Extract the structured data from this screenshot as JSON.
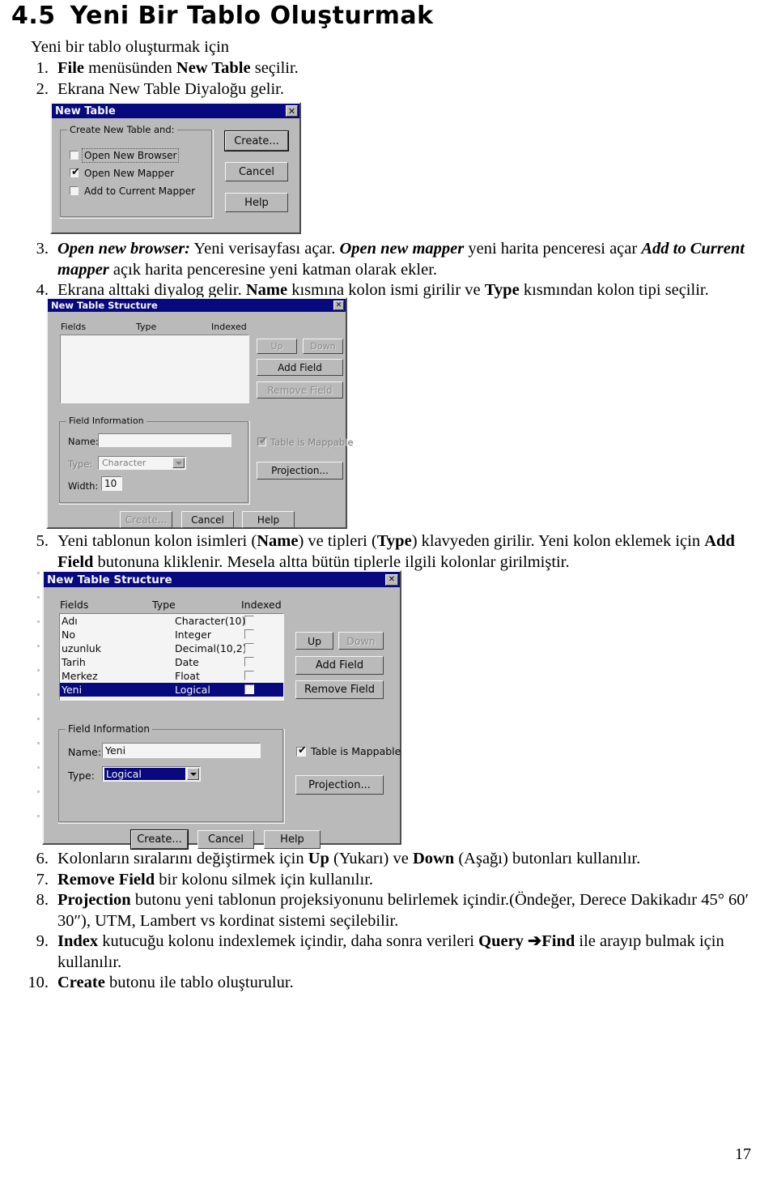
{
  "document": {
    "heading_number": "4.5",
    "heading_title": "Yeni Bir Tablo Oluşturmak",
    "intro": "Yeni bir tablo oluşturmak için",
    "page_number": "17",
    "steps": [
      {
        "marker": "1.",
        "parts": [
          {
            "t": "File",
            "s": "b"
          },
          {
            "t": " menüsünden ",
            "s": "n"
          },
          {
            "t": "New Table",
            "s": "b"
          },
          {
            "t": " seçilir.",
            "s": "n"
          }
        ]
      },
      {
        "marker": "2.",
        "parts": [
          {
            "t": "Ekrana New Table Diyaloğu gelir.",
            "s": "n"
          }
        ]
      },
      {
        "marker": "3.",
        "parts": [
          {
            "t": "Open new browser:",
            "s": "bi"
          },
          {
            "t": " Yeni verisayfası açar. ",
            "s": "n"
          },
          {
            "t": "Open new mapper",
            "s": "bi"
          },
          {
            "t": " yeni harita penceresi açar ",
            "s": "n"
          },
          {
            "t": "Add to Current mapper",
            "s": "bi"
          },
          {
            "t": " açık harita penceresine yeni katman olarak ekler.",
            "s": "n"
          }
        ]
      },
      {
        "marker": "4.",
        "parts": [
          {
            "t": "Ekrana alttaki diyalog gelir. ",
            "s": "n"
          },
          {
            "t": "Name",
            "s": "b"
          },
          {
            "t": " kısmına kolon ismi girilir ve ",
            "s": "n"
          },
          {
            "t": "Type",
            "s": "b"
          },
          {
            "t": " kısmından kolon tipi seçilir.",
            "s": "n"
          }
        ]
      },
      {
        "marker": "5.",
        "parts": [
          {
            "t": "Yeni tablonun kolon isimleri (",
            "s": "n"
          },
          {
            "t": "Name",
            "s": "b"
          },
          {
            "t": ") ve tipleri (",
            "s": "n"
          },
          {
            "t": "Type",
            "s": "b"
          },
          {
            "t": ") klavyeden girilir. Yeni kolon eklemek için ",
            "s": "n"
          },
          {
            "t": "Add Field",
            "s": "b"
          },
          {
            "t": " butonuna kliklenir. Mesela altta bütün tiplerle ilgili kolonlar girilmiştir.",
            "s": "n"
          }
        ]
      },
      {
        "marker": "6.",
        "parts": [
          {
            "t": "Kolonların sıralarını değiştirmek için ",
            "s": "n"
          },
          {
            "t": "Up",
            "s": "b"
          },
          {
            "t": " (Yukarı) ve ",
            "s": "n"
          },
          {
            "t": "Down",
            "s": "b"
          },
          {
            "t": " (Aşağı) butonları kullanılır.",
            "s": "n"
          }
        ]
      },
      {
        "marker": "7.",
        "parts": [
          {
            "t": "Remove Field",
            "s": "b"
          },
          {
            "t": " bir kolonu silmek için kullanılır.",
            "s": "n"
          }
        ]
      },
      {
        "marker": "8.",
        "parts": [
          {
            "t": "Projection",
            "s": "b"
          },
          {
            "t": " butonu yeni tablonun projeksiyonunu belirlemek içindir.(Öndeğer, Derece Dakikadır 45° 60′ 30″), UTM, Lambert vs kordinat sistemi seçilebilir.",
            "s": "n"
          }
        ]
      },
      {
        "marker": "9.",
        "parts": [
          {
            "t": "Index",
            "s": "b"
          },
          {
            "t": " kutucuğu kolonu indexlemek içindir, daha sonra verileri ",
            "s": "n"
          },
          {
            "t": "Query ",
            "s": "b"
          },
          {
            "t": "➔",
            "s": "b"
          },
          {
            "t": "Find",
            "s": "b"
          },
          {
            "t": " ile arayıp bulmak için kullanılır.",
            "s": "n"
          }
        ]
      },
      {
        "marker": "10.",
        "parts": [
          {
            "t": "Create",
            "s": "b"
          },
          {
            "t": " butonu ile tablo oluşturulur.",
            "s": "n"
          }
        ]
      }
    ]
  },
  "dialog_new_table": {
    "title": "New Table",
    "close_label": "✕",
    "group_label": "Create New Table and:",
    "checkboxes": [
      {
        "label": "Open New Browser",
        "checked": false,
        "underline": "B"
      },
      {
        "label": "Open New Mapper",
        "checked": true,
        "underline": "M"
      },
      {
        "label": "Add to Current Mapper",
        "checked": false,
        "underline": "A"
      }
    ],
    "buttons": [
      {
        "label": "Create...",
        "enabled": true
      },
      {
        "label": "Cancel",
        "enabled": true
      },
      {
        "label": "Help",
        "enabled": true
      }
    ]
  },
  "dialog_structure_empty": {
    "title": "New Table Structure",
    "close_label": "✕",
    "columns": [
      "Fields",
      "Type",
      "Indexed"
    ],
    "rows": [],
    "side_buttons": [
      {
        "label": "Up",
        "enabled": false
      },
      {
        "label": "Down",
        "enabled": false
      },
      {
        "label": "Add Field",
        "enabled": true
      },
      {
        "label": "Remove Field",
        "enabled": false
      }
    ],
    "group_label": "Field Information",
    "name_label": "Name:",
    "name_value": "",
    "type_label": "Type:",
    "type_value": "Character",
    "type_enabled": false,
    "width_label": "Width:",
    "width_value": "10",
    "mappable_label": "Table is Mappable",
    "mappable_checked": true,
    "mappable_enabled": false,
    "projection_label": "Projection...",
    "bottom_buttons": [
      {
        "label": "Create...",
        "enabled": false
      },
      {
        "label": "Cancel",
        "enabled": true
      },
      {
        "label": "Help",
        "enabled": true
      }
    ]
  },
  "dialog_structure_filled": {
    "title": "New Table Structure",
    "close_label": "✕",
    "columns": [
      "Fields",
      "Type",
      "Indexed"
    ],
    "rows": [
      {
        "field": "Adı",
        "type": "Character(10)",
        "indexed": false,
        "selected": false
      },
      {
        "field": "No",
        "type": "Integer",
        "indexed": false,
        "selected": false
      },
      {
        "field": "uzunluk",
        "type": "Decimal(10,2)",
        "indexed": false,
        "selected": false
      },
      {
        "field": "Tarih",
        "type": "Date",
        "indexed": false,
        "selected": false
      },
      {
        "field": "Merkez",
        "type": "Float",
        "indexed": false,
        "selected": false
      },
      {
        "field": "Yeni",
        "type": "Logical",
        "indexed": false,
        "selected": true
      }
    ],
    "side_buttons": [
      {
        "label": "Up",
        "enabled": true
      },
      {
        "label": "Down",
        "enabled": false
      },
      {
        "label": "Add Field",
        "enabled": true
      },
      {
        "label": "Remove Field",
        "enabled": true
      }
    ],
    "group_label": "Field Information",
    "name_label": "Name:",
    "name_value": "Yeni",
    "type_label": "Type:",
    "type_value": "Logical",
    "type_enabled": true,
    "mappable_label": "Table is Mappable",
    "mappable_checked": true,
    "mappable_enabled": true,
    "projection_label": "Projection...",
    "bottom_buttons": [
      {
        "label": "Create...",
        "enabled": true
      },
      {
        "label": "Cancel",
        "enabled": true
      },
      {
        "label": "Help",
        "enabled": true
      }
    ]
  },
  "colors": {
    "title_bar": "#000080",
    "dialog_face": "#c0c0c0",
    "selection": "#000080",
    "text": "#000000"
  }
}
